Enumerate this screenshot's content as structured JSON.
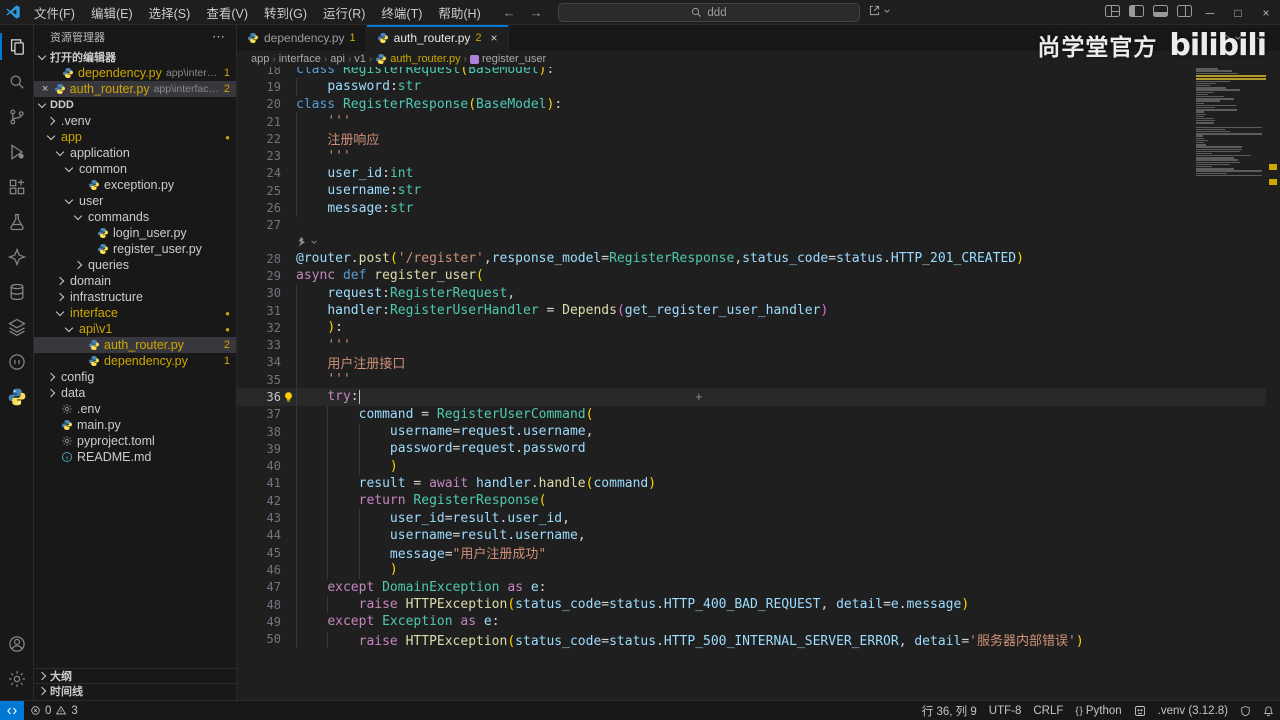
{
  "palette": {
    "accent": "#0078d4",
    "warn": "#cca700",
    "remote_bg": "#0078d4",
    "code": {
      "k": "#569cd6",
      "c": "#c586c0",
      "t": "#4ec9b0",
      "f": "#dcdcaa",
      "v": "#9cdcfe",
      "s": "#ce9178",
      "w": "#d4d4d4",
      "p": "#ffd700",
      "q": "#da70d6"
    }
  },
  "title_bar": {
    "menus": [
      "文件(F)",
      "编辑(E)",
      "选择(S)",
      "查看(V)",
      "转到(G)",
      "运行(R)",
      "终端(T)",
      "帮助(H)"
    ],
    "menu_names": [
      "file",
      "edit",
      "selection",
      "view",
      "go",
      "run",
      "terminal",
      "help"
    ],
    "back": "←",
    "forward": "→",
    "search_value": "ddd",
    "window_controls": [
      "─",
      "□",
      "×"
    ]
  },
  "activity_bar": {
    "top": [
      "explorer",
      "search",
      "source-control",
      "run-debug",
      "extensions",
      "testing",
      "ai",
      "database",
      "layers",
      "bot",
      "python"
    ],
    "bottom": [
      "account",
      "settings"
    ]
  },
  "explorer": {
    "title": "资源管理器",
    "more_actions": "⋯",
    "open_editors_label": "打开的编辑器",
    "open_editors": [
      {
        "name": "dependency.py",
        "desc": "app\\interface",
        "badge": "1",
        "selected": false,
        "close": ""
      },
      {
        "name": "auth_router.py",
        "desc": "app\\interface\\api...",
        "badge": "2",
        "selected": true,
        "close": "×"
      }
    ],
    "root": "DDD",
    "tree": [
      {
        "label": ".venv",
        "level": 1,
        "kind": "folder",
        "state": "col"
      },
      {
        "label": "app",
        "level": 1,
        "kind": "folder",
        "state": "exp",
        "warn": true,
        "dot": "●"
      },
      {
        "label": "application",
        "level": 2,
        "kind": "folder",
        "state": "exp"
      },
      {
        "label": "common",
        "level": 3,
        "kind": "folder",
        "state": "exp"
      },
      {
        "label": "exception.py",
        "level": 4,
        "kind": "file",
        "icon": "python"
      },
      {
        "label": "user",
        "level": 3,
        "kind": "folder",
        "state": "exp"
      },
      {
        "label": "commands",
        "level": 4,
        "kind": "folder",
        "state": "exp"
      },
      {
        "label": "login_user.py",
        "level": 5,
        "kind": "file",
        "icon": "python"
      },
      {
        "label": "register_user.py",
        "level": 5,
        "kind": "file",
        "icon": "python"
      },
      {
        "label": "queries",
        "level": 4,
        "kind": "folder",
        "state": "col"
      },
      {
        "label": "domain",
        "level": 2,
        "kind": "folder",
        "state": "col"
      },
      {
        "label": "infrastructure",
        "level": 2,
        "kind": "folder",
        "state": "col"
      },
      {
        "label": "interface",
        "level": 2,
        "kind": "folder",
        "state": "exp",
        "warn": true,
        "dot": "●"
      },
      {
        "label": "api\\v1",
        "level": 3,
        "kind": "folder",
        "state": "exp",
        "warn": true,
        "dot": "●"
      },
      {
        "label": "auth_router.py",
        "level": 4,
        "kind": "file",
        "icon": "python",
        "warn": true,
        "badge": "2",
        "selected": true
      },
      {
        "label": "dependency.py",
        "level": 4,
        "kind": "file",
        "icon": "python",
        "warn": true,
        "badge": "1"
      },
      {
        "label": "config",
        "level": 1,
        "kind": "folder",
        "state": "col"
      },
      {
        "label": "data",
        "level": 1,
        "kind": "folder",
        "state": "col"
      },
      {
        "label": ".env",
        "level": 1,
        "kind": "file",
        "icon": "gear"
      },
      {
        "label": "main.py",
        "level": 1,
        "kind": "file",
        "icon": "python"
      },
      {
        "label": "pyproject.toml",
        "level": 1,
        "kind": "file",
        "icon": "gear"
      },
      {
        "label": "README.md",
        "level": 1,
        "kind": "file",
        "icon": "info"
      }
    ],
    "outline_label": "大纲",
    "timeline_label": "时间线"
  },
  "tabs": [
    {
      "name": "dependency.py",
      "badge": "1",
      "active": false
    },
    {
      "name": "auth_router.py",
      "badge": "2",
      "active": true,
      "close": "×"
    }
  ],
  "breadcrumb": [
    {
      "t": "app"
    },
    {
      "t": "interface"
    },
    {
      "t": "api"
    },
    {
      "t": "v1"
    },
    {
      "t": "auth_router.py",
      "icon": "python",
      "warn": true
    },
    {
      "t": "register_user",
      "icon": "symbol"
    }
  ],
  "watermark": {
    "text": "尚学堂官方",
    "logo": "bilibili"
  },
  "editor": {
    "current_line": 36,
    "plus_label": "+",
    "codelens_after": 27,
    "lines": [
      {
        "n": 18,
        "t": [
          [
            "k",
            "class"
          ],
          [
            "w",
            " "
          ],
          [
            "t",
            "RegisterRequest"
          ],
          [
            "p",
            "("
          ],
          [
            "t",
            "BaseModel"
          ],
          [
            "p",
            ")"
          ],
          [
            "w",
            ":"
          ]
        ]
      },
      {
        "n": 19,
        "t": [
          [
            "w",
            "    "
          ],
          [
            "v",
            "password"
          ],
          [
            "w",
            ":"
          ],
          [
            "t",
            "str"
          ]
        ]
      },
      {
        "n": 20,
        "t": [
          [
            "k",
            "class"
          ],
          [
            "w",
            " "
          ],
          [
            "t",
            "RegisterResponse"
          ],
          [
            "p",
            "("
          ],
          [
            "t",
            "BaseModel"
          ],
          [
            "p",
            ")"
          ],
          [
            "w",
            ":"
          ]
        ]
      },
      {
        "n": 21,
        "t": [
          [
            "w",
            "    "
          ],
          [
            "s",
            "'''"
          ]
        ]
      },
      {
        "n": 22,
        "t": [
          [
            "w",
            "    "
          ],
          [
            "s",
            "注册响应"
          ]
        ]
      },
      {
        "n": 23,
        "t": [
          [
            "w",
            "    "
          ],
          [
            "s",
            "'''"
          ]
        ]
      },
      {
        "n": 24,
        "t": [
          [
            "w",
            "    "
          ],
          [
            "v",
            "user_id"
          ],
          [
            "w",
            ":"
          ],
          [
            "t",
            "int"
          ]
        ]
      },
      {
        "n": 25,
        "t": [
          [
            "w",
            "    "
          ],
          [
            "v",
            "username"
          ],
          [
            "w",
            ":"
          ],
          [
            "t",
            "str"
          ]
        ]
      },
      {
        "n": 26,
        "t": [
          [
            "w",
            "    "
          ],
          [
            "v",
            "message"
          ],
          [
            "w",
            ":"
          ],
          [
            "t",
            "str"
          ]
        ]
      },
      {
        "n": 27,
        "t": []
      },
      {
        "n": 28,
        "t": [
          [
            "v",
            "@router"
          ],
          [
            "w",
            "."
          ],
          [
            "f",
            "post"
          ],
          [
            "p",
            "("
          ],
          [
            "s",
            "'/register'"
          ],
          [
            "w",
            ","
          ],
          [
            "v",
            "response_model"
          ],
          [
            "w",
            "="
          ],
          [
            "t",
            "RegisterResponse"
          ],
          [
            "w",
            ","
          ],
          [
            "v",
            "status_code"
          ],
          [
            "w",
            "="
          ],
          [
            "v",
            "status"
          ],
          [
            "w",
            "."
          ],
          [
            "v",
            "HTTP_201_CREATED"
          ],
          [
            "p",
            ")"
          ]
        ]
      },
      {
        "n": 29,
        "t": [
          [
            "c",
            "async"
          ],
          [
            "w",
            " "
          ],
          [
            "k",
            "def"
          ],
          [
            "w",
            " "
          ],
          [
            "f",
            "register_user"
          ],
          [
            "p",
            "("
          ]
        ]
      },
      {
        "n": 30,
        "t": [
          [
            "w",
            "    "
          ],
          [
            "v",
            "request"
          ],
          [
            "w",
            ":"
          ],
          [
            "t",
            "RegisterRequest"
          ],
          [
            "w",
            ","
          ]
        ]
      },
      {
        "n": 31,
        "t": [
          [
            "w",
            "    "
          ],
          [
            "v",
            "handler"
          ],
          [
            "w",
            ":"
          ],
          [
            "t",
            "RegisterUserHandler"
          ],
          [
            "w",
            " = "
          ],
          [
            "f",
            "Depends"
          ],
          [
            "q",
            "("
          ],
          [
            "v",
            "get_register_user_handler"
          ],
          [
            "q",
            ")"
          ]
        ]
      },
      {
        "n": 32,
        "t": [
          [
            "w",
            "    "
          ],
          [
            "p",
            ")"
          ],
          [
            "w",
            ":"
          ]
        ]
      },
      {
        "n": 33,
        "t": [
          [
            "w",
            "    "
          ],
          [
            "s",
            "'''"
          ]
        ]
      },
      {
        "n": 34,
        "t": [
          [
            "w",
            "    "
          ],
          [
            "s",
            "用户注册接口"
          ]
        ]
      },
      {
        "n": 35,
        "t": [
          [
            "w",
            "    "
          ],
          [
            "s",
            "'''"
          ]
        ]
      },
      {
        "n": 36,
        "t": [
          [
            "w",
            "    "
          ],
          [
            "c",
            "try"
          ],
          [
            "w",
            ":"
          ]
        ]
      },
      {
        "n": 37,
        "t": [
          [
            "w",
            "        "
          ],
          [
            "v",
            "command"
          ],
          [
            "w",
            " = "
          ],
          [
            "t",
            "RegisterUserCommand"
          ],
          [
            "p",
            "("
          ]
        ]
      },
      {
        "n": 38,
        "t": [
          [
            "w",
            "            "
          ],
          [
            "v",
            "username"
          ],
          [
            "w",
            "="
          ],
          [
            "v",
            "request"
          ],
          [
            "w",
            "."
          ],
          [
            "v",
            "username"
          ],
          [
            "w",
            ","
          ]
        ]
      },
      {
        "n": 39,
        "t": [
          [
            "w",
            "            "
          ],
          [
            "v",
            "password"
          ],
          [
            "w",
            "="
          ],
          [
            "v",
            "request"
          ],
          [
            "w",
            "."
          ],
          [
            "v",
            "password"
          ]
        ]
      },
      {
        "n": 40,
        "t": [
          [
            "w",
            "            "
          ],
          [
            "p",
            ")"
          ]
        ]
      },
      {
        "n": 41,
        "t": [
          [
            "w",
            "        "
          ],
          [
            "v",
            "result"
          ],
          [
            "w",
            " = "
          ],
          [
            "c",
            "await"
          ],
          [
            "w",
            " "
          ],
          [
            "v",
            "handler"
          ],
          [
            "w",
            "."
          ],
          [
            "f",
            "handle"
          ],
          [
            "p",
            "("
          ],
          [
            "v",
            "command"
          ],
          [
            "p",
            ")"
          ]
        ]
      },
      {
        "n": 42,
        "t": [
          [
            "w",
            "        "
          ],
          [
            "c",
            "return"
          ],
          [
            "w",
            " "
          ],
          [
            "t",
            "RegisterResponse"
          ],
          [
            "p",
            "("
          ]
        ]
      },
      {
        "n": 43,
        "t": [
          [
            "w",
            "            "
          ],
          [
            "v",
            "user_id"
          ],
          [
            "w",
            "="
          ],
          [
            "v",
            "result"
          ],
          [
            "w",
            "."
          ],
          [
            "v",
            "user_id"
          ],
          [
            "w",
            ","
          ]
        ]
      },
      {
        "n": 44,
        "t": [
          [
            "w",
            "            "
          ],
          [
            "v",
            "username"
          ],
          [
            "w",
            "="
          ],
          [
            "v",
            "result"
          ],
          [
            "w",
            "."
          ],
          [
            "v",
            "username"
          ],
          [
            "w",
            ","
          ]
        ]
      },
      {
        "n": 45,
        "t": [
          [
            "w",
            "            "
          ],
          [
            "v",
            "message"
          ],
          [
            "w",
            "="
          ],
          [
            "s",
            "\"用户注册成功\""
          ]
        ]
      },
      {
        "n": 46,
        "t": [
          [
            "w",
            "            "
          ],
          [
            "p",
            ")"
          ]
        ]
      },
      {
        "n": 47,
        "t": [
          [
            "w",
            "    "
          ],
          [
            "c",
            "except"
          ],
          [
            "w",
            " "
          ],
          [
            "t",
            "DomainException"
          ],
          [
            "w",
            " "
          ],
          [
            "c",
            "as"
          ],
          [
            "w",
            " "
          ],
          [
            "v",
            "e"
          ],
          [
            "w",
            ":"
          ]
        ]
      },
      {
        "n": 48,
        "t": [
          [
            "w",
            "        "
          ],
          [
            "c",
            "raise"
          ],
          [
            "w",
            " "
          ],
          [
            "f",
            "HTTPException"
          ],
          [
            "p",
            "("
          ],
          [
            "v",
            "status_code"
          ],
          [
            "w",
            "="
          ],
          [
            "v",
            "status"
          ],
          [
            "w",
            "."
          ],
          [
            "v",
            "HTTP_400_BAD_REQUEST"
          ],
          [
            "w",
            ", "
          ],
          [
            "v",
            "detail"
          ],
          [
            "w",
            "="
          ],
          [
            "v",
            "e"
          ],
          [
            "w",
            "."
          ],
          [
            "v",
            "message"
          ],
          [
            "p",
            ")"
          ]
        ]
      },
      {
        "n": 49,
        "t": [
          [
            "w",
            "    "
          ],
          [
            "c",
            "except"
          ],
          [
            "w",
            " "
          ],
          [
            "t",
            "Exception"
          ],
          [
            "w",
            " "
          ],
          [
            "c",
            "as"
          ],
          [
            "w",
            " "
          ],
          [
            "v",
            "e"
          ],
          [
            "w",
            ":"
          ]
        ]
      },
      {
        "n": 50,
        "t": [
          [
            "w",
            "        "
          ],
          [
            "c",
            "raise"
          ],
          [
            "w",
            " "
          ],
          [
            "f",
            "HTTPException"
          ],
          [
            "p",
            "("
          ],
          [
            "v",
            "status_code"
          ],
          [
            "w",
            "="
          ],
          [
            "v",
            "status"
          ],
          [
            "w",
            "."
          ],
          [
            "v",
            "HTTP_500_INTERNAL_SERVER_ERROR"
          ],
          [
            "w",
            ", "
          ],
          [
            "v",
            "detail"
          ],
          [
            "w",
            "="
          ],
          [
            "s",
            "'服务器内部错误'"
          ],
          [
            "p",
            ")"
          ]
        ]
      }
    ]
  },
  "minimap": {
    "pre_widths": [
      30,
      22,
      36,
      42,
      10,
      26,
      34,
      20,
      14,
      30,
      44,
      18,
      12,
      28,
      38,
      24,
      8
    ],
    "warn_rows": [
      4,
      5
    ]
  },
  "status_bar": {
    "errors": "0",
    "warnings": "3",
    "right": [
      {
        "t": "行 36, 列 9",
        "name": "cursor-position"
      },
      {
        "t": "UTF-8",
        "name": "encoding"
      },
      {
        "t": "CRLF",
        "name": "eol"
      },
      {
        "i": "braces",
        "t": "Python",
        "name": "language-mode"
      },
      {
        "i": "grid",
        "t": "",
        "name": "extension-status"
      },
      {
        "t": ".venv (3.12.8)",
        "name": "python-interpreter"
      },
      {
        "i": "shield",
        "t": "",
        "name": "shield-status"
      },
      {
        "i": "bell",
        "t": "",
        "name": "notifications"
      }
    ]
  }
}
